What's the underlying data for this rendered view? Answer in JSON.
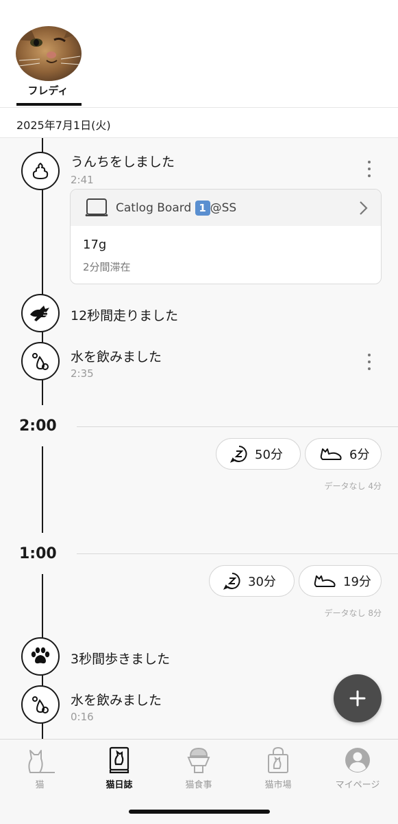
{
  "header": {
    "cat_name": "フレディ",
    "date": "2025年7月1日(火)"
  },
  "timeline": {
    "events": [
      {
        "icon": "poop-icon",
        "title": "うんちをしました",
        "time": "2:41"
      },
      {
        "icon": "running-cat-icon",
        "title": "12秒間走りました"
      },
      {
        "icon": "water-drop-icon",
        "title": "水を飲みました",
        "time": "2:35"
      },
      {
        "icon": "paw-icon",
        "title": "3秒間歩きました"
      },
      {
        "icon": "water-drop-icon",
        "title": "水を飲みました",
        "time": "0:16"
      }
    ],
    "device_card": {
      "device_name": "Catlog Board",
      "device_number": "1",
      "location": "@SS",
      "weight": "17g",
      "stay": "2分間滞在"
    },
    "hours": [
      {
        "label": "2:00",
        "sleep": "50分",
        "rest": "6分",
        "no_data": "データなし 4分"
      },
      {
        "label": "1:00",
        "sleep": "30分",
        "rest": "19分",
        "no_data": "データなし 8分"
      }
    ]
  },
  "fab": {
    "icon": "plus-icon"
  },
  "nav": {
    "tabs": [
      {
        "label": "猫",
        "icon": "cat-icon",
        "active": false
      },
      {
        "label": "猫日誌",
        "icon": "diary-icon",
        "active": true
      },
      {
        "label": "猫食事",
        "icon": "food-bowl-icon",
        "active": false
      },
      {
        "label": "猫市場",
        "icon": "shopping-bag-icon",
        "active": false
      },
      {
        "label": "マイページ",
        "icon": "account-icon",
        "active": false
      }
    ]
  },
  "colors": {
    "accent": "#111111",
    "fab": "#4b4b4b",
    "muted_text": "#9a9a9a",
    "device_badge": "#5a8fd0"
  }
}
